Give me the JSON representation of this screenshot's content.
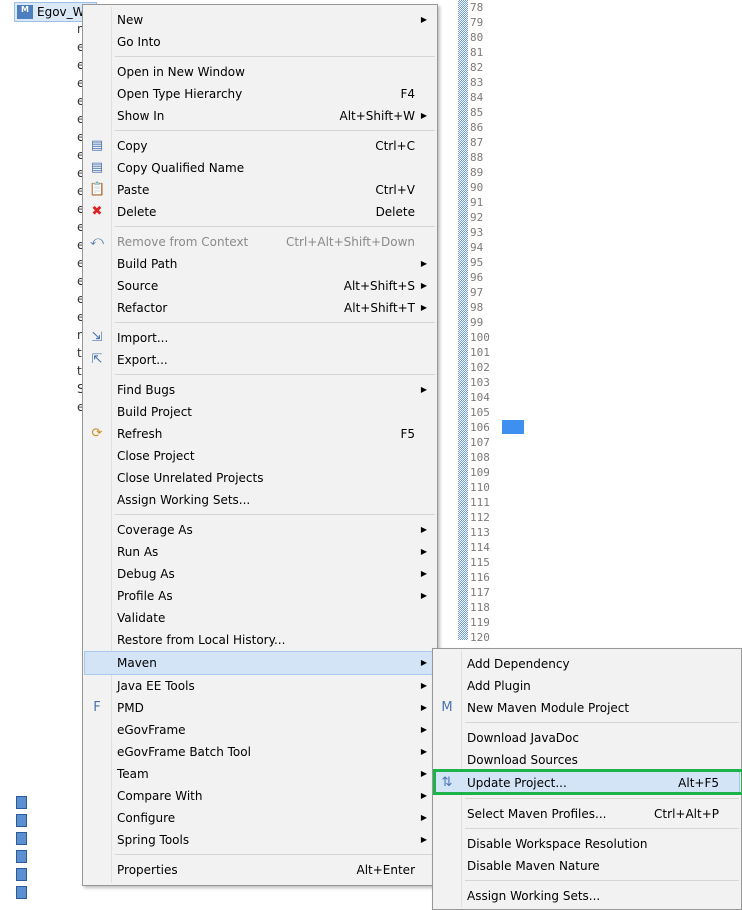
{
  "tree": {
    "project": "Egov_WE",
    "fragments": [
      "n",
      "e",
      "e",
      "e",
      "e",
      "e",
      "e",
      "e",
      "e",
      "e",
      "e",
      "e",
      "e",
      "e",
      "e",
      "e",
      "e",
      "n",
      "te",
      "te",
      "S",
      "e"
    ]
  },
  "editor": {
    "line_numbers": [
      "78",
      "79",
      "80",
      "81",
      "82",
      "83",
      "84",
      "85",
      "86",
      "87",
      "88",
      "89",
      "90",
      "91",
      "92",
      "93",
      "94",
      "95",
      "96",
      "97",
      "98",
      "99",
      "100",
      "101",
      "102",
      "103",
      "104",
      "105",
      "106",
      "107",
      "108",
      "109",
      "110",
      "111",
      "112",
      "113",
      "114",
      "115",
      "116",
      "117",
      "118",
      "119",
      "120"
    ]
  },
  "context_menu": {
    "groups": [
      [
        {
          "label": "New",
          "submenu": true
        },
        {
          "label": "Go Into"
        }
      ],
      [
        {
          "label": "Open in New Window"
        },
        {
          "label": "Open Type Hierarchy",
          "shortcut": "F4"
        },
        {
          "label": "Show In",
          "shortcut": "Alt+Shift+W",
          "submenu": true
        }
      ],
      [
        {
          "label": "Copy",
          "shortcut": "Ctrl+C",
          "icon": "copy-icon"
        },
        {
          "label": "Copy Qualified Name",
          "icon": "copy-qualified-icon"
        },
        {
          "label": "Paste",
          "shortcut": "Ctrl+V",
          "icon": "paste-icon"
        },
        {
          "label": "Delete",
          "shortcut": "Delete",
          "icon": "delete-icon"
        }
      ],
      [
        {
          "label": "Remove from Context",
          "shortcut": "Ctrl+Alt+Shift+Down",
          "disabled": true,
          "icon": "remove-context-icon"
        },
        {
          "label": "Build Path",
          "submenu": true
        },
        {
          "label": "Source",
          "shortcut": "Alt+Shift+S",
          "submenu": true
        },
        {
          "label": "Refactor",
          "shortcut": "Alt+Shift+T",
          "submenu": true
        }
      ],
      [
        {
          "label": "Import...",
          "icon": "import-icon"
        },
        {
          "label": "Export...",
          "icon": "export-icon"
        }
      ],
      [
        {
          "label": "Find Bugs",
          "submenu": true
        },
        {
          "label": "Build Project"
        },
        {
          "label": "Refresh",
          "shortcut": "F5",
          "icon": "refresh-icon"
        },
        {
          "label": "Close Project"
        },
        {
          "label": "Close Unrelated Projects"
        },
        {
          "label": "Assign Working Sets..."
        }
      ],
      [
        {
          "label": "Coverage As",
          "submenu": true
        },
        {
          "label": "Run As",
          "submenu": true
        },
        {
          "label": "Debug As",
          "submenu": true
        },
        {
          "label": "Profile As",
          "submenu": true
        },
        {
          "label": "Validate"
        },
        {
          "label": "Restore from Local History..."
        },
        {
          "label": "Maven",
          "submenu": true,
          "highlighted": true
        },
        {
          "label": "Java EE Tools",
          "submenu": true
        },
        {
          "label": "PMD",
          "submenu": true,
          "icon": "pmd-icon"
        },
        {
          "label": "eGovFrame",
          "submenu": true
        },
        {
          "label": "eGovFrame Batch Tool",
          "submenu": true
        },
        {
          "label": "Team",
          "submenu": true
        },
        {
          "label": "Compare With",
          "submenu": true
        },
        {
          "label": "Configure",
          "submenu": true
        },
        {
          "label": "Spring Tools",
          "submenu": true
        }
      ],
      [
        {
          "label": "Properties",
          "shortcut": "Alt+Enter"
        }
      ]
    ]
  },
  "maven_submenu": {
    "groups": [
      [
        {
          "label": "Add Dependency"
        },
        {
          "label": "Add Plugin"
        },
        {
          "label": "New Maven Module Project",
          "icon": "maven-module-icon"
        }
      ],
      [
        {
          "label": "Download JavaDoc"
        },
        {
          "label": "Download Sources"
        },
        {
          "label": "Update Project...",
          "shortcut": "Alt+F5",
          "icon": "update-project-icon",
          "highlighted": true
        }
      ],
      [
        {
          "label": "Select Maven Profiles...",
          "shortcut": "Ctrl+Alt+P"
        }
      ],
      [
        {
          "label": "Disable Workspace Resolution"
        },
        {
          "label": "Disable Maven Nature"
        }
      ],
      [
        {
          "label": "Assign Working Sets..."
        }
      ]
    ]
  },
  "colors": {
    "highlight_box": "#1eb34a",
    "selection": "#3d8ff0"
  }
}
